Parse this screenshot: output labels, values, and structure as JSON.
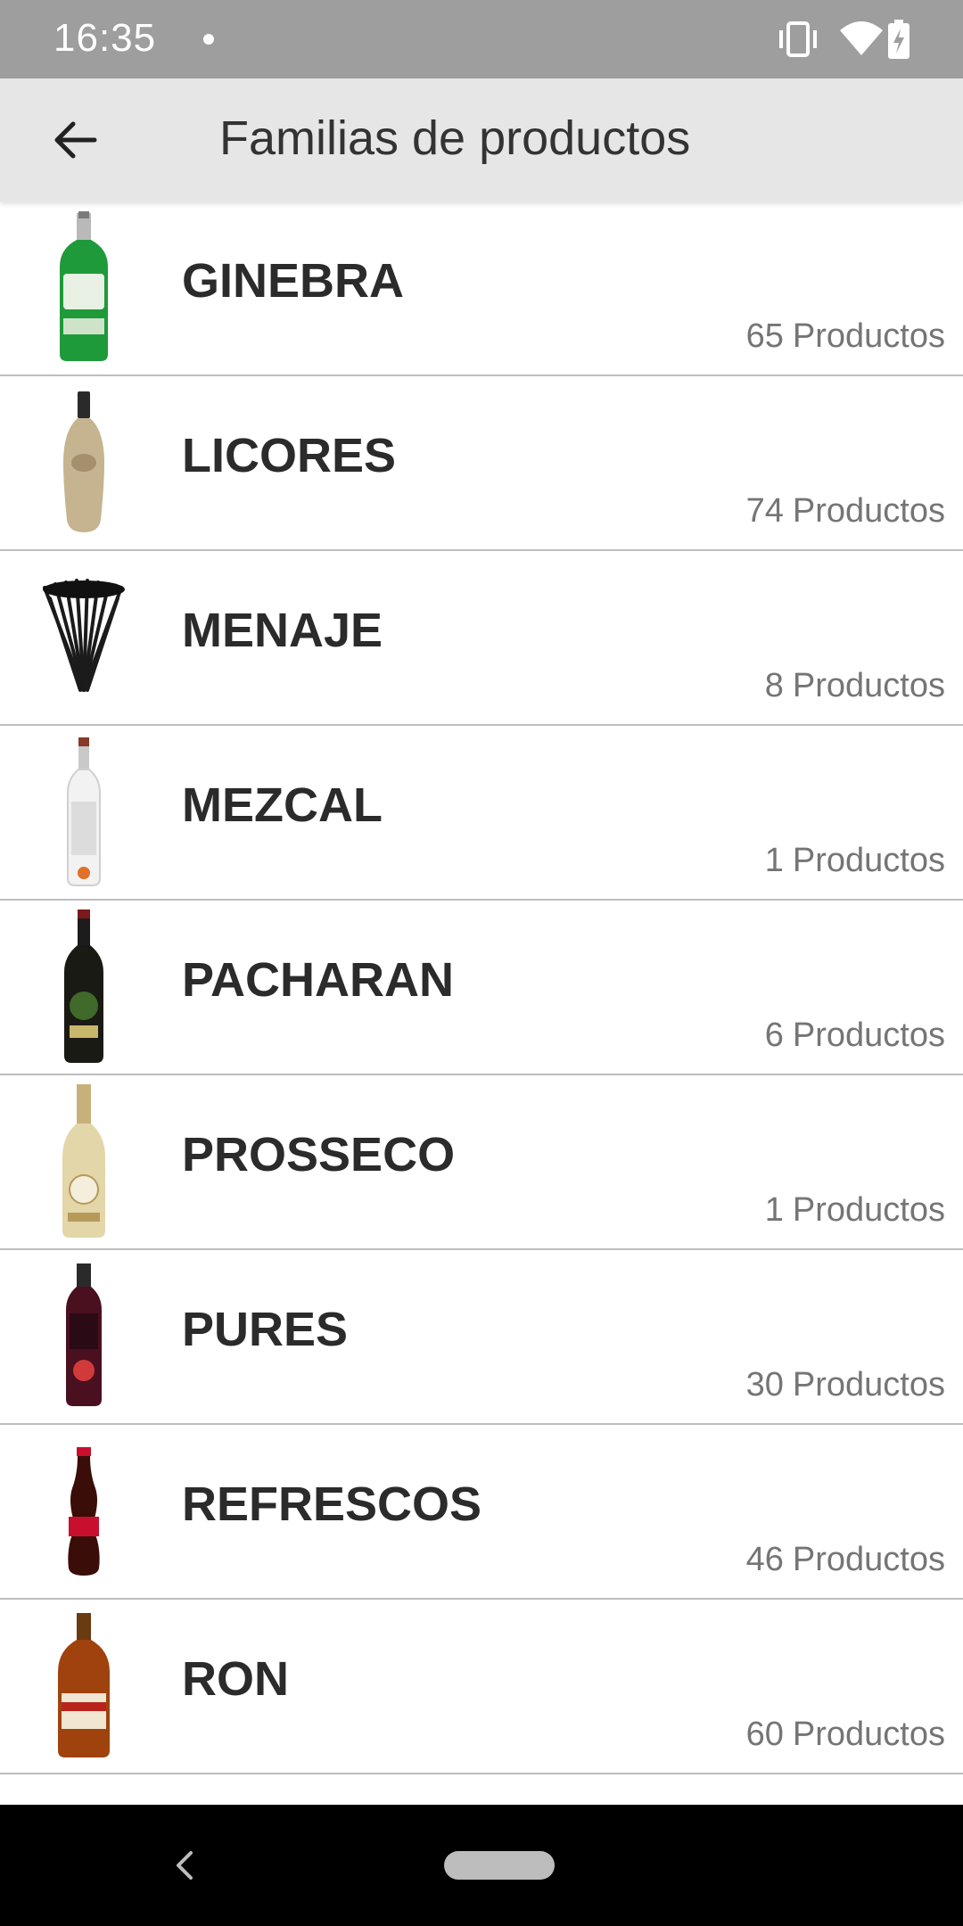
{
  "status_bar": {
    "time": "16:35",
    "icons": [
      "notification-dot-icon",
      "vibrate-icon",
      "wifi-icon",
      "battery-charging-icon"
    ]
  },
  "app_bar": {
    "back_icon": "arrow-left-icon",
    "title": "Familias de productos"
  },
  "colors": {
    "status_bar": "#9e9e9e",
    "app_bar": "#e6e6e6",
    "title_text": "#333333",
    "name_text": "#2b2b2b",
    "count_text": "#757575",
    "divider": "#bdbdbd",
    "nav_bar": "#000000"
  },
  "families": [
    {
      "name": "GINEBRA",
      "count": "65",
      "unit": "Productos",
      "thumb": "gin-bottle"
    },
    {
      "name": "LICORES",
      "count": "74",
      "unit": "Productos",
      "thumb": "liqueur-bottle"
    },
    {
      "name": "MENAJE",
      "count": "8",
      "unit": "Productos",
      "thumb": "straws"
    },
    {
      "name": "MEZCAL",
      "count": "1",
      "unit": "Productos",
      "thumb": "mezcal-bottle"
    },
    {
      "name": "PACHARAN",
      "count": "6",
      "unit": "Productos",
      "thumb": "pacharan-bottle"
    },
    {
      "name": "PROSSECO",
      "count": "1",
      "unit": "Productos",
      "thumb": "prosecco-bottle"
    },
    {
      "name": "PURES",
      "count": "30",
      "unit": "Productos",
      "thumb": "puree-bottle"
    },
    {
      "name": "REFRESCOS",
      "count": "46",
      "unit": "Productos",
      "thumb": "cola-bottle"
    },
    {
      "name": "RON",
      "count": "60",
      "unit": "Productos",
      "thumb": "rum-bottle"
    }
  ],
  "nav_bar": {
    "back_icon": "nav-back-icon",
    "home_icon": "home-pill-icon"
  }
}
